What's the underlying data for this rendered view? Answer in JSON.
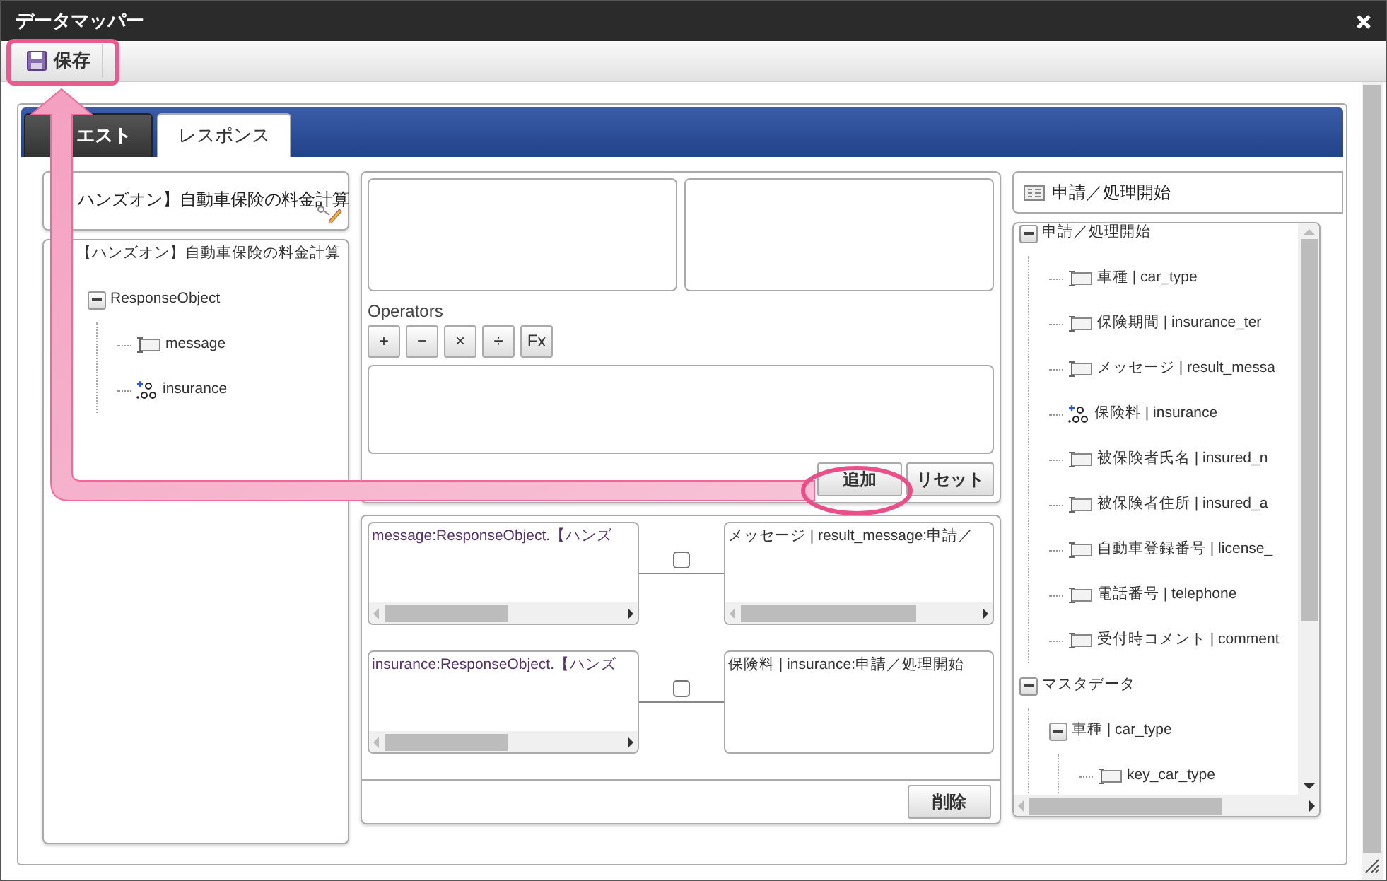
{
  "window": {
    "title": "データマッパー"
  },
  "toolbar": {
    "save_button": "保存"
  },
  "tabs": [
    {
      "label": "エスト",
      "selected": false
    },
    {
      "label": "レスポンス",
      "selected": true
    }
  ],
  "source": {
    "title": "ハンズオン】自動車保険の料金計算",
    "tree": [
      {
        "label": "【ハンズオン】自動車保険の料金計算",
        "children": [
          {
            "label": "ResponseObject",
            "expanded": true,
            "children": [
              {
                "label": "message",
                "kind": "string"
              },
              {
                "label": "insurance",
                "kind": "number"
              }
            ]
          }
        ]
      }
    ]
  },
  "expression": {
    "operators_label": "Operators",
    "operators": [
      "+",
      "−",
      "×",
      "÷",
      "Fx"
    ],
    "add_button": "追加",
    "reset_button": "リセット"
  },
  "mappings": [
    {
      "source": "message:ResponseObject.【ハンズ",
      "target": "メッセージ | result_message:申請／",
      "checked": false,
      "target_scroll": true
    },
    {
      "source": "insurance:ResponseObject.【ハンズ",
      "target": "保険料 | insurance:申請／処理開始",
      "checked": false,
      "target_scroll": false
    }
  ],
  "delete_button": "削除",
  "target": {
    "title": "申請／処理開始",
    "tree": [
      {
        "label": "申請／処理開始",
        "expanded": true,
        "children": [
          {
            "label": "車種 | car_type",
            "kind": "string"
          },
          {
            "label": "保険期間 | insurance_ter",
            "kind": "string"
          },
          {
            "label": "メッセージ | result_messa",
            "kind": "string"
          },
          {
            "label": "保険料 | insurance",
            "kind": "number"
          },
          {
            "label": "被保険者氏名 | insured_n",
            "kind": "string"
          },
          {
            "label": "被保険者住所 | insured_a",
            "kind": "string"
          },
          {
            "label": "自動車登録番号 | license_",
            "kind": "string"
          },
          {
            "label": "電話番号 | telephone",
            "kind": "string"
          },
          {
            "label": "受付時コメント | comment",
            "kind": "string"
          }
        ]
      },
      {
        "label": "マスタデータ",
        "expanded": true,
        "children": [
          {
            "label": "車種 | car_type",
            "expanded": true,
            "children": [
              {
                "label": "key_car_type",
                "kind": "string"
              }
            ]
          }
        ]
      }
    ]
  }
}
